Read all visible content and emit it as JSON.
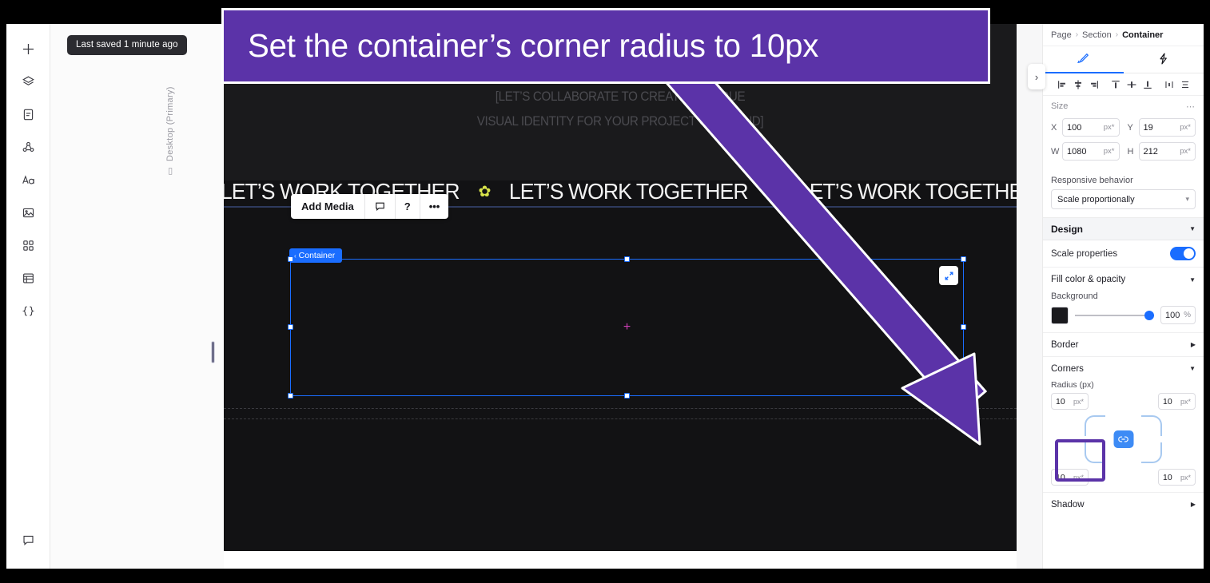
{
  "annotation": {
    "banner_text": "Set the container’s corner radius to 10px",
    "banner_color": "#5B33A8",
    "arrow_color": "#5B33A8",
    "highlight_target": "Radius (px)"
  },
  "left_rail": {
    "items": [
      {
        "name": "add-icon",
        "label": "Add"
      },
      {
        "name": "layers-icon",
        "label": "Layers"
      },
      {
        "name": "pages-icon",
        "label": "Pages"
      },
      {
        "name": "connect-icon",
        "label": "Connect"
      },
      {
        "name": "text-icon",
        "label": "Text"
      },
      {
        "name": "media-icon",
        "label": "Media"
      },
      {
        "name": "apps-icon",
        "label": "Apps"
      },
      {
        "name": "content-manager-icon",
        "label": "Content Manager"
      },
      {
        "name": "dev-mode-icon",
        "label": "Dev Mode"
      }
    ],
    "bottom_item": {
      "name": "comments-icon",
      "label": "Comments"
    }
  },
  "workspace": {
    "saved_status": "Last saved 1 minute ago",
    "device_label": "Desktop (Primary)"
  },
  "canvas": {
    "toolbar": {
      "add_media": "Add Media",
      "comment_icon": "comment-icon",
      "help_label": "?",
      "more_label": "•••"
    },
    "selection_tag": "Container",
    "hero_line_1": "[LET’S COLLABORATE TO CREATE A UNIQUE",
    "hero_line_2": "VISUAL IDENTITY FOR YOUR PROJECT OR BRAND]",
    "marquee_item": "LET’S WORK TOGETHER",
    "marquee_separator": "✿",
    "marquee_repeats": 4,
    "separator_color": "#D8E34A",
    "selection_color": "#1A6DFF",
    "background_color": "#121214"
  },
  "panel": {
    "breadcrumb": {
      "level1": "Page",
      "level2": "Section",
      "level3": "Container",
      "separator": "›"
    },
    "tabs": [
      {
        "name": "design-tab",
        "icon": "brush-icon",
        "active": true
      },
      {
        "name": "interactions-tab",
        "icon": "lightning-icon",
        "active": false
      }
    ],
    "align_tools": [
      "align-left-icon",
      "align-center-horizontal-icon",
      "align-right-icon",
      "align-top-icon",
      "align-middle-vertical-icon",
      "align-bottom-icon",
      "distribute-horizontal-icon",
      "distribute-vertical-icon"
    ],
    "size": {
      "title": "Size",
      "more": "⋯",
      "x": {
        "label": "X",
        "value": "100",
        "unit": "px*"
      },
      "y": {
        "label": "Y",
        "value": "19",
        "unit": "px*"
      },
      "w": {
        "label": "W",
        "value": "1080",
        "unit": "px*"
      },
      "h": {
        "label": "H",
        "value": "212",
        "unit": "px*"
      }
    },
    "responsive": {
      "label": "Responsive behavior",
      "value": "Scale proportionally"
    },
    "design_section": {
      "title": "Design",
      "caret": "▼"
    },
    "scale_properties": {
      "label": "Scale properties",
      "enabled": true
    },
    "fill": {
      "title": "Fill color & opacity",
      "caret": "▼",
      "background_label": "Background",
      "swatch_color": "#1A1A1E",
      "opacity_value": "100",
      "opacity_unit": "%"
    },
    "border": {
      "title": "Border",
      "caret": "▶"
    },
    "corners": {
      "title": "Corners",
      "caret": "▼",
      "radius_label": "Radius (px)",
      "top_left": {
        "value": "10",
        "unit": "px*"
      },
      "top_right": {
        "value": "10",
        "unit": "px*"
      },
      "bottom_left": {
        "value": "10",
        "unit": "px*"
      },
      "bottom_right": {
        "value": "10",
        "unit": "px*"
      },
      "link_icon": "link-corners-icon"
    },
    "shadow": {
      "title": "Shadow",
      "caret": "▶"
    },
    "collapse_button": "›"
  }
}
